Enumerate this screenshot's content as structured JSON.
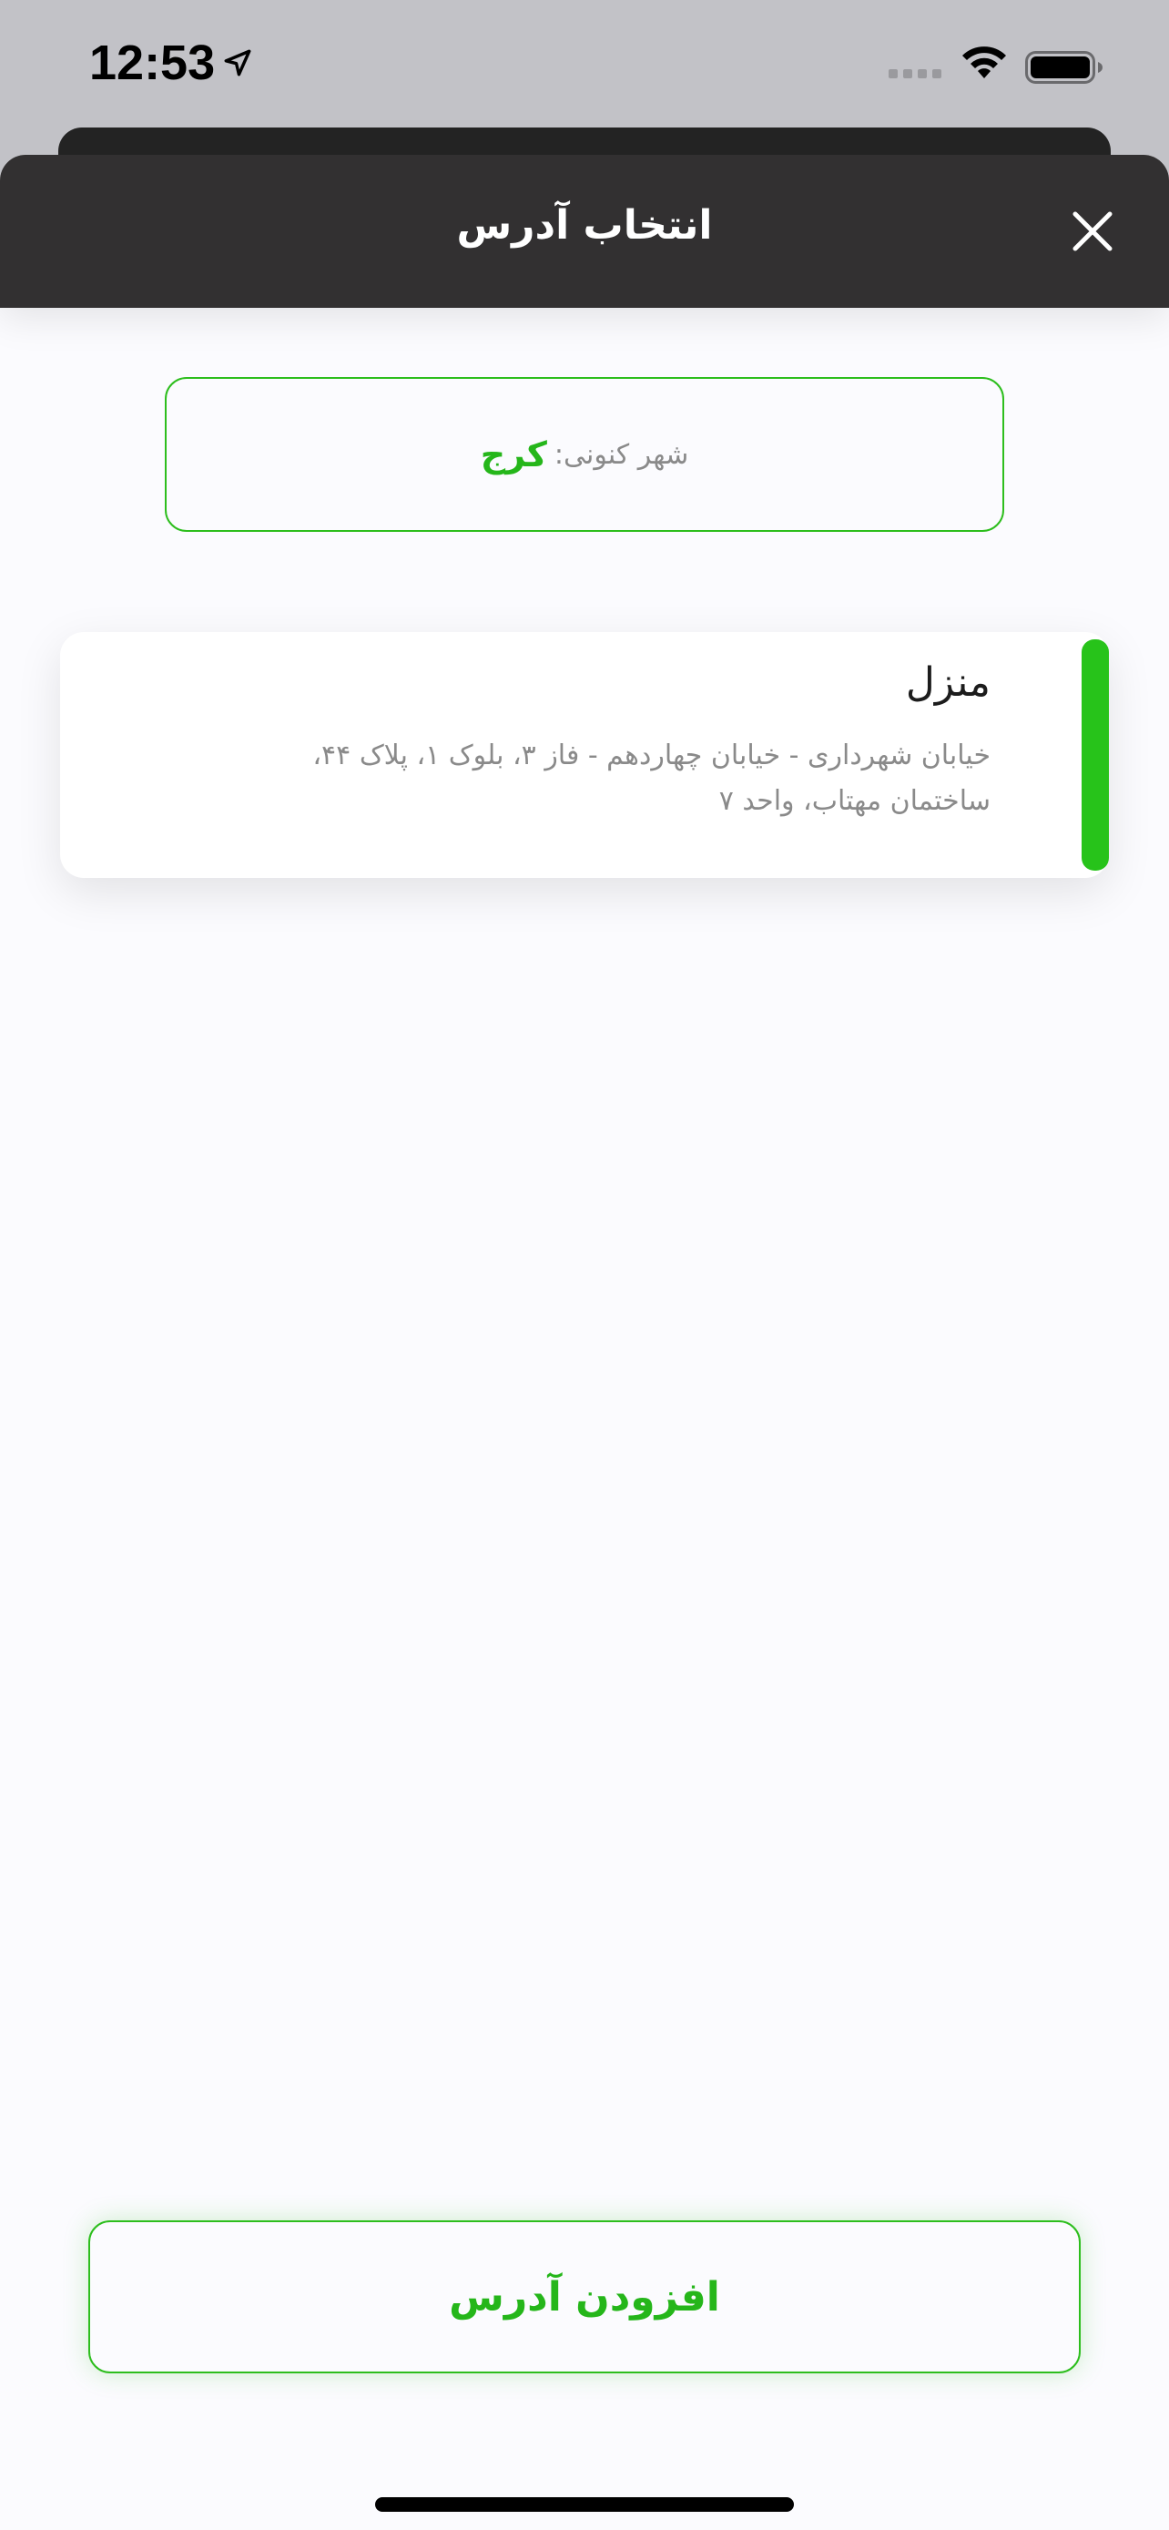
{
  "status_bar": {
    "time": "12:53",
    "location_icon": "location-arrow-icon",
    "signal_icon": "cellular-signal-icon",
    "wifi_icon": "wifi-icon",
    "battery_icon": "battery-full-icon"
  },
  "header": {
    "title": "انتخاب آدرس",
    "close_icon": "close-icon"
  },
  "city": {
    "label": "شهر کنونی:",
    "value": "کرج"
  },
  "addresses": [
    {
      "title": "منزل",
      "line1": "خیابان شهرداری  - خیابان چهاردهم - فاز ۳، بلوک ۱، پلاک ۴۴،",
      "line2": "ساختمان مهتاب، واحد ۷",
      "selected": true
    }
  ],
  "add_button": {
    "label": "افزودن آدرس"
  },
  "colors": {
    "accent_green": "#27c31a",
    "header_bg": "#323031",
    "sheet_bg": "#fbfbfe",
    "status_bg": "#c2c2c7",
    "secondary_text": "#8a8a8a"
  }
}
